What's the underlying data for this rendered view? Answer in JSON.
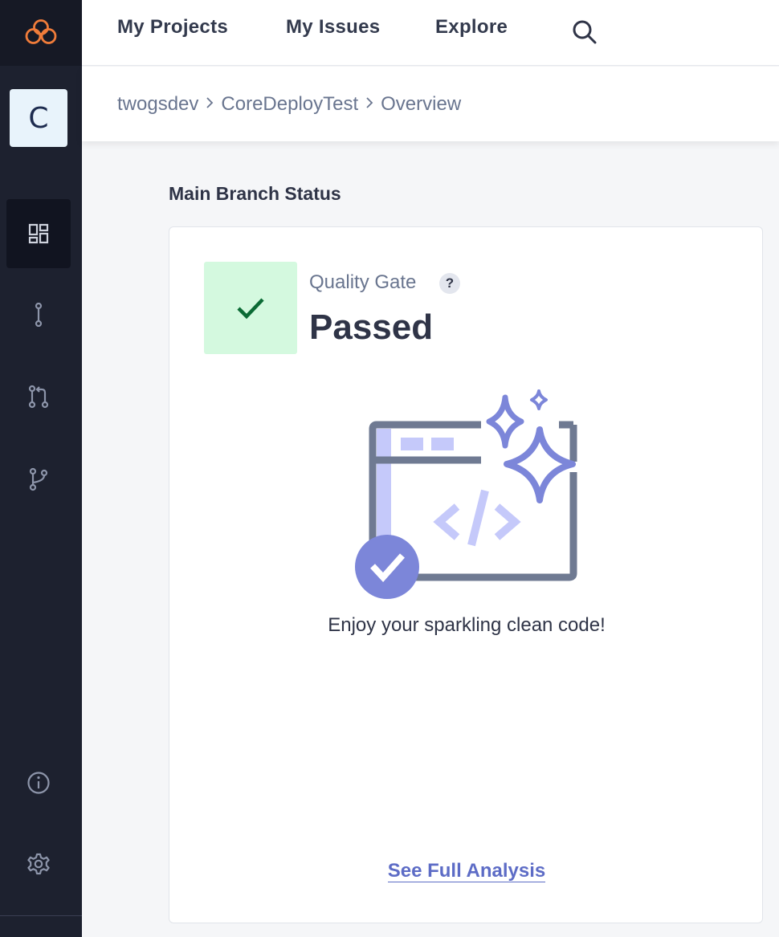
{
  "topnav": {
    "projects_label": "My Projects",
    "issues_label": "My Issues",
    "explore_label": "Explore",
    "search_icon": "search-icon"
  },
  "sidebar": {
    "logo_icon": "cloud-logo-icon",
    "project_initial": "C",
    "items": [
      {
        "name": "overview",
        "icon": "dashboard-icon",
        "active": true
      },
      {
        "name": "branches",
        "icon": "branch-icon",
        "active": false
      },
      {
        "name": "pull-requests",
        "icon": "pull-request-icon",
        "active": false
      },
      {
        "name": "forks",
        "icon": "fork-icon",
        "active": false
      }
    ],
    "bottom_items": [
      {
        "name": "information",
        "icon": "info-icon"
      },
      {
        "name": "settings",
        "icon": "gear-icon"
      }
    ]
  },
  "breadcrumb": {
    "organization": "twogsdev",
    "project": "CoreDeployTest",
    "page": "Overview"
  },
  "main": {
    "section_title": "Main Branch Status",
    "quality_gate": {
      "label": "Quality Gate",
      "help": "?",
      "status": "Passed"
    },
    "message": "Enjoy your sparkling clean code!",
    "full_analysis_label": "See Full Analysis"
  },
  "colors": {
    "sidebar_bg": "#1d212f",
    "logo_accent": "#f07c3a",
    "passed_bg": "#d4f9df",
    "passed_check": "#0b6b35",
    "link": "#5d6cc6",
    "illustration_accent": "#7c86d9"
  }
}
